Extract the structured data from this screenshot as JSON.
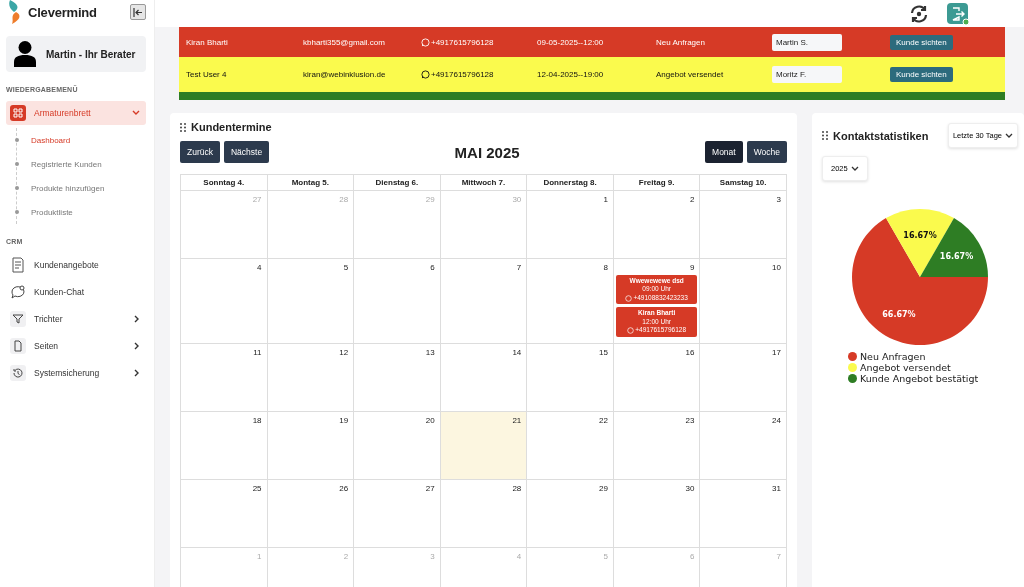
{
  "brand": {
    "name": "Clevermind"
  },
  "user": {
    "name": "Martin - Ihr Berater"
  },
  "sidebar": {
    "sections": [
      {
        "title": "WIEDERGABEMENÜ",
        "items": [
          {
            "label": "Armaturenbrett",
            "kind": "group",
            "expanded": true,
            "selected": true,
            "children": [
              {
                "label": "Dashboard",
                "selected": true
              },
              {
                "label": "Registrierte Kunden",
                "selected": false
              },
              {
                "label": "Produkte hinzufügen",
                "selected": false
              },
              {
                "label": "Produktliste",
                "selected": false
              }
            ]
          }
        ]
      },
      {
        "title": "CRM",
        "items": [
          {
            "label": "Kundenangebote",
            "kind": "link",
            "selected": false
          },
          {
            "label": "Kunden-Chat",
            "kind": "link",
            "selected": false
          },
          {
            "label": "Trichter",
            "kind": "group",
            "expanded": false,
            "selected": false
          },
          {
            "label": "Seiten",
            "kind": "group",
            "expanded": false,
            "selected": false
          },
          {
            "label": "Systemsicherung",
            "kind": "group",
            "expanded": false,
            "selected": false
          }
        ]
      }
    ]
  },
  "leads": [
    {
      "name": "Kiran Bharti",
      "email": "kbharti355@gmail.com",
      "phone": "+4917615796128",
      "date": "09-05-2025--12:00",
      "status": "Neu Anfragen",
      "advisor": "Martin S.",
      "action": "Kunde sichten",
      "color": "#d63a26"
    },
    {
      "name": "Test User 4",
      "email": "kiran@webinklusion.de",
      "phone": "+4917615796128",
      "date": "12-04-2025--19:00",
      "status": "Angebot versendet",
      "advisor": "Moritz F.",
      "action": "Kunde sichten",
      "color": "#fafa4d"
    },
    {
      "color": "#2e7d24"
    }
  ],
  "calendar": {
    "title": "Kundentermine",
    "nav": [
      "Zurück",
      "Nächste"
    ],
    "month": "MAI 2025",
    "views": [
      {
        "label": "Monat",
        "selected": true
      },
      {
        "label": "Woche",
        "selected": false
      }
    ],
    "weekdays": [
      "Sonntag 4.",
      "Montag 5.",
      "Dienstag 6.",
      "Mittwoch 7.",
      "Donnerstag 8.",
      "Freitag 9.",
      "Samstag 10."
    ],
    "weeks": [
      [
        {
          "n": "27",
          "outside": true,
          "today": false
        },
        {
          "n": "28",
          "outside": true,
          "today": false
        },
        {
          "n": "29",
          "outside": true,
          "today": false
        },
        {
          "n": "30",
          "outside": true,
          "today": false
        },
        {
          "n": "1",
          "outside": false,
          "today": false
        },
        {
          "n": "2",
          "outside": false,
          "today": false
        },
        {
          "n": "3",
          "outside": false,
          "today": false
        }
      ],
      [
        {
          "n": "4",
          "outside": false,
          "today": false
        },
        {
          "n": "5",
          "outside": false,
          "today": false
        },
        {
          "n": "6",
          "outside": false,
          "today": false
        },
        {
          "n": "7",
          "outside": false,
          "today": false
        },
        {
          "n": "8",
          "outside": false,
          "today": false
        },
        {
          "n": "9",
          "outside": false,
          "today": false,
          "events": [
            {
              "title": "Wwewewewe dsd",
              "time": "09:00 Uhr",
              "phone": "+49108832423233"
            },
            {
              "title": "Kiran Bharti",
              "time": "12:00 Uhr",
              "phone": "+4917615796128"
            }
          ]
        },
        {
          "n": "10",
          "outside": false,
          "today": false
        }
      ],
      [
        {
          "n": "11",
          "outside": false,
          "today": false
        },
        {
          "n": "12",
          "outside": false,
          "today": false
        },
        {
          "n": "13",
          "outside": false,
          "today": false
        },
        {
          "n": "14",
          "outside": false,
          "today": false
        },
        {
          "n": "15",
          "outside": false,
          "today": false
        },
        {
          "n": "16",
          "outside": false,
          "today": false
        },
        {
          "n": "17",
          "outside": false,
          "today": false
        }
      ],
      [
        {
          "n": "18",
          "outside": false,
          "today": false
        },
        {
          "n": "19",
          "outside": false,
          "today": false
        },
        {
          "n": "20",
          "outside": false,
          "today": false
        },
        {
          "n": "21",
          "outside": false,
          "today": true
        },
        {
          "n": "22",
          "outside": false,
          "today": false
        },
        {
          "n": "23",
          "outside": false,
          "today": false
        },
        {
          "n": "24",
          "outside": false,
          "today": false
        }
      ],
      [
        {
          "n": "25",
          "outside": false,
          "today": false
        },
        {
          "n": "26",
          "outside": false,
          "today": false
        },
        {
          "n": "27",
          "outside": false,
          "today": false
        },
        {
          "n": "28",
          "outside": false,
          "today": false
        },
        {
          "n": "29",
          "outside": false,
          "today": false
        },
        {
          "n": "30",
          "outside": false,
          "today": false
        },
        {
          "n": "31",
          "outside": false,
          "today": false
        }
      ],
      [
        {
          "n": "1",
          "outside": true,
          "today": false
        },
        {
          "n": "2",
          "outside": true,
          "today": false
        },
        {
          "n": "3",
          "outside": true,
          "today": false
        },
        {
          "n": "4",
          "outside": true,
          "today": false
        },
        {
          "n": "5",
          "outside": true,
          "today": false
        },
        {
          "n": "6",
          "outside": true,
          "today": false
        },
        {
          "n": "7",
          "outside": true,
          "today": false
        }
      ]
    ]
  },
  "stats": {
    "title": "Kontaktstatistiken",
    "range": "Letzte 30 Tage",
    "year": "2025",
    "chart_data": {
      "type": "pie",
      "categories": [
        "Neu Anfragen",
        "Angebot versendet",
        "Kunde Angebot bestätigt"
      ],
      "values": [
        66.67,
        16.67,
        16.67
      ],
      "colors": [
        "#d63a26",
        "#fafa4d",
        "#2e7d24"
      ],
      "value_labels": [
        "66.67%",
        "16.67%",
        "16.67%"
      ]
    }
  }
}
